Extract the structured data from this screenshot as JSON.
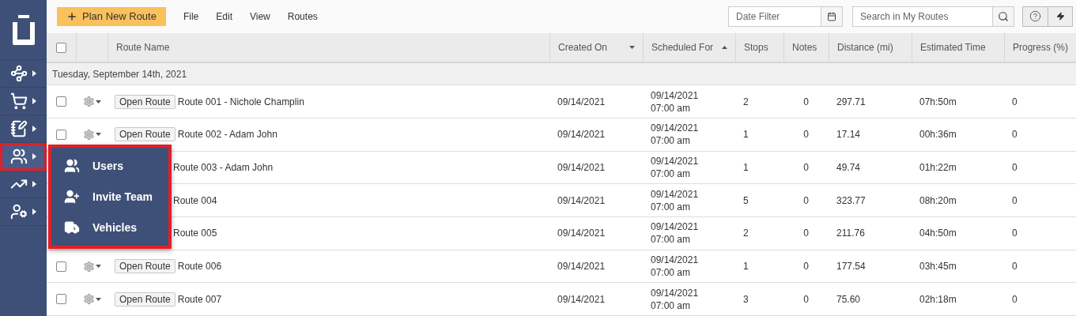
{
  "toolbar": {
    "primary_button": "Plan New Route",
    "menu": [
      "File",
      "Edit",
      "View",
      "Routes"
    ],
    "date_filter": {
      "placeholder": "Date Filter"
    },
    "search": {
      "placeholder": "Search in My Routes"
    }
  },
  "sidebar": {
    "items": [
      {
        "selected": false
      },
      {
        "selected": false
      },
      {
        "selected": false
      },
      {
        "selected": true
      },
      {
        "selected": false
      },
      {
        "selected": false
      }
    ]
  },
  "popup_menu": {
    "items": [
      {
        "label": "Users"
      },
      {
        "label": "Invite Team"
      },
      {
        "label": "Vehicles"
      }
    ]
  },
  "table": {
    "select_all_checked": false,
    "columns": [
      {
        "label": "Route Name",
        "sorted": false
      },
      {
        "label": "Created On",
        "sorted": true,
        "descending": true
      },
      {
        "label": "Scheduled For",
        "sorted": true,
        "descending": false
      },
      {
        "label": "Stops",
        "sorted": false
      },
      {
        "label": "Notes",
        "sorted": false
      },
      {
        "label": "Distance (mi)",
        "sorted": false
      },
      {
        "label": "Estimated Time",
        "sorted": false
      },
      {
        "label": "Progress (%)",
        "sorted": false
      }
    ],
    "group": "Tuesday, September 14th, 2021",
    "rows": [
      {
        "controls_visible": true,
        "checked": false,
        "open_button": "Open Route",
        "name": "Route 001 - Nichole Champlin",
        "created": "09/14/2021",
        "scheduled_date": "09/14/2021",
        "scheduled_time": "07:00 am",
        "stops": "2",
        "notes": "0",
        "distance": "297.71",
        "time": "07h:50m",
        "progress": "0"
      },
      {
        "controls_visible": true,
        "checked": false,
        "open_button": "Open Route",
        "name": "Route 002 - Adam John",
        "created": "09/14/2021",
        "scheduled_date": "09/14/2021",
        "scheduled_time": "07:00 am",
        "stops": "1",
        "notes": "0",
        "distance": "17.14",
        "time": "00h:36m",
        "progress": "0"
      },
      {
        "controls_visible": false,
        "name": "Route 003 - Adam John",
        "created": "09/14/2021",
        "scheduled_date": "09/14/2021",
        "scheduled_time": "07:00 am",
        "stops": "1",
        "notes": "0",
        "distance": "49.74",
        "time": "01h:22m",
        "progress": "0"
      },
      {
        "controls_visible": false,
        "name": "Route 004",
        "created": "09/14/2021",
        "scheduled_date": "09/14/2021",
        "scheduled_time": "07:00 am",
        "stops": "5",
        "notes": "0",
        "distance": "323.77",
        "time": "08h:20m",
        "progress": "0"
      },
      {
        "controls_visible": false,
        "name": "Route 005",
        "created": "09/14/2021",
        "scheduled_date": "09/14/2021",
        "scheduled_time": "07:00 am",
        "stops": "2",
        "notes": "0",
        "distance": "211.76",
        "time": "04h:50m",
        "progress": "0"
      },
      {
        "controls_visible": true,
        "checked": false,
        "open_button": "Open Route",
        "name": "Route 006",
        "created": "09/14/2021",
        "scheduled_date": "09/14/2021",
        "scheduled_time": "07:00 am",
        "stops": "1",
        "notes": "0",
        "distance": "177.54",
        "time": "03h:45m",
        "progress": "0"
      },
      {
        "controls_visible": true,
        "checked": false,
        "open_button": "Open Route",
        "name": "Route 007",
        "created": "09/14/2021",
        "scheduled_date": "09/14/2021",
        "scheduled_time": "07:00 am",
        "stops": "3",
        "notes": "0",
        "distance": "75.60",
        "time": "02h:18m",
        "progress": "0"
      }
    ]
  }
}
